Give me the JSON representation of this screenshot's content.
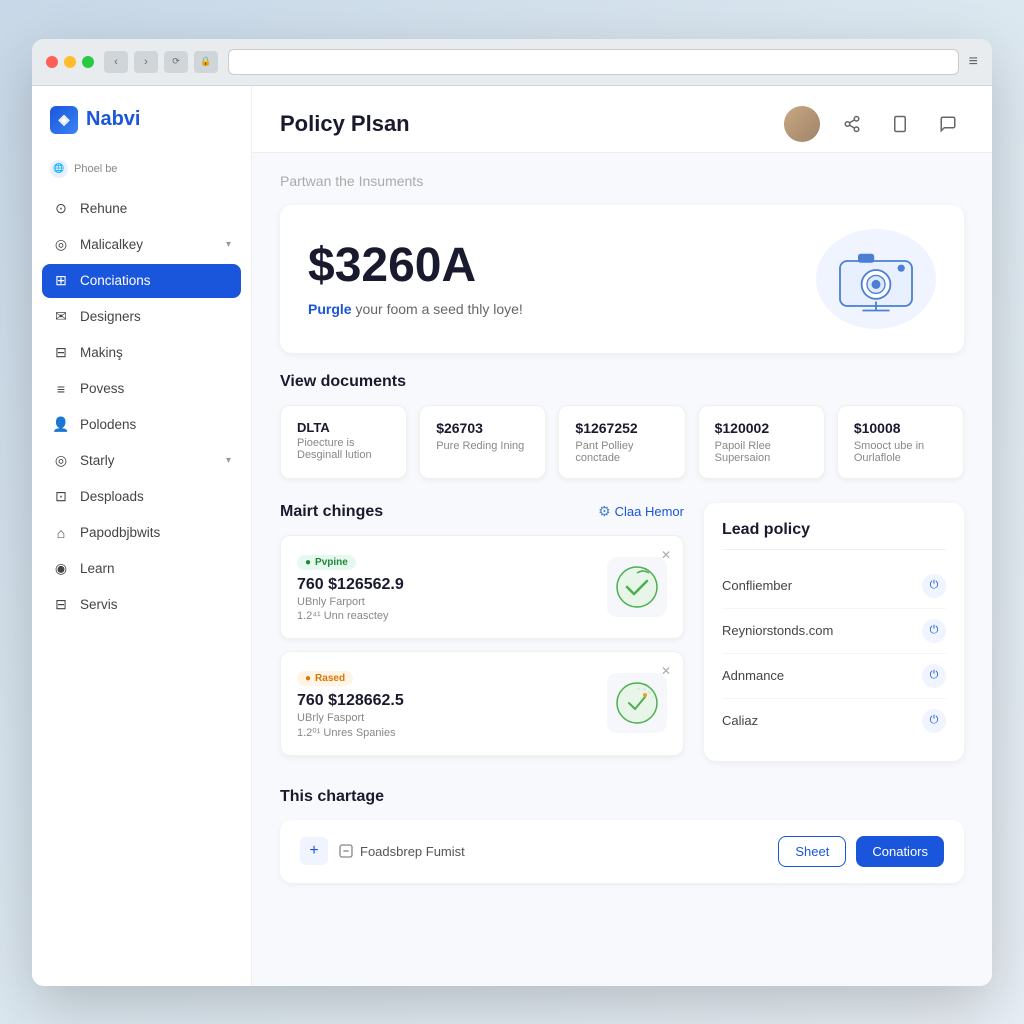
{
  "browser": {
    "address": ""
  },
  "logo": {
    "text": "Nabvi",
    "icon": "◈"
  },
  "sidebar": {
    "section_label": "Phoel be",
    "items": [
      {
        "id": "rehune",
        "label": "Rehune",
        "icon": "⊙",
        "active": false
      },
      {
        "id": "malicalkey",
        "label": "Malicalkey",
        "icon": "◎",
        "active": false,
        "chevron": true
      },
      {
        "id": "conciations",
        "label": "Conciations",
        "icon": "⊞",
        "active": true
      },
      {
        "id": "designers",
        "label": "Designers",
        "icon": "✉",
        "active": false
      },
      {
        "id": "making",
        "label": "Makinş",
        "icon": "⊟",
        "active": false
      },
      {
        "id": "povess",
        "label": "Povess",
        "icon": "≡",
        "active": false
      },
      {
        "id": "polodens",
        "label": "Polodens",
        "icon": "👤",
        "active": false
      },
      {
        "id": "starly",
        "label": "Starly",
        "icon": "◎",
        "active": false,
        "chevron": true
      },
      {
        "id": "desploads",
        "label": "Desploads",
        "icon": "⊡",
        "active": false
      },
      {
        "id": "papodbjbwits",
        "label": "Papodbjbwits",
        "icon": "⌂",
        "active": false
      },
      {
        "id": "learn",
        "label": "Learn",
        "icon": "◉",
        "active": false
      },
      {
        "id": "servis",
        "label": "Servis",
        "icon": "⊟",
        "active": false
      }
    ]
  },
  "header": {
    "page_title": "Policy Plsan",
    "icons": [
      "share",
      "tablet",
      "chat"
    ]
  },
  "breadcrumb": {
    "text": "Partwan the",
    "sub": "Insuments"
  },
  "hero": {
    "amount": "$3260A",
    "subtitle_pre": "Purgle",
    "subtitle_post": "your foom a seed thly loye!"
  },
  "documents": {
    "section_title": "View documents",
    "cards": [
      {
        "title": "DLTA",
        "subtitle": "Pioecture is Desginall lution"
      },
      {
        "amount": "$26703",
        "subtitle": "Pure Reding Ining"
      },
      {
        "amount": "$1267252",
        "subtitle": "Pant Polliey conctade"
      },
      {
        "amount": "$120002",
        "subtitle": "Papoil Rlee Supersaion"
      },
      {
        "amount": "$10008",
        "subtitle": "Smooct ube in Ourlaflole"
      }
    ]
  },
  "changes": {
    "section_title": "Mairt chinges",
    "link": "Claa Hemor",
    "cards": [
      {
        "badge": "Pvpine",
        "badge_type": "green",
        "amount": "760 $126562.9",
        "desc_line1": "UBnly Farport",
        "desc_line2": "1.2⁴¹ Unn reasctey"
      },
      {
        "badge": "Rased",
        "badge_type": "orange",
        "amount": "760 $128662.5",
        "desc_line1": "UBrly Fasport",
        "desc_line2": "1.2⁰¹ Unres Spanies"
      }
    ]
  },
  "lead_policy": {
    "title": "Lead policy",
    "items": [
      {
        "label": "Confliember"
      },
      {
        "label": "Reyniorstonds.com"
      },
      {
        "label": "Adnmance"
      },
      {
        "label": "Caliaz"
      }
    ]
  },
  "chartage": {
    "section_title": "This chartage",
    "file_label": "Foadsbrep Fumist",
    "button_sheet": "Sheet",
    "button_conatiors": "Conatiors"
  }
}
